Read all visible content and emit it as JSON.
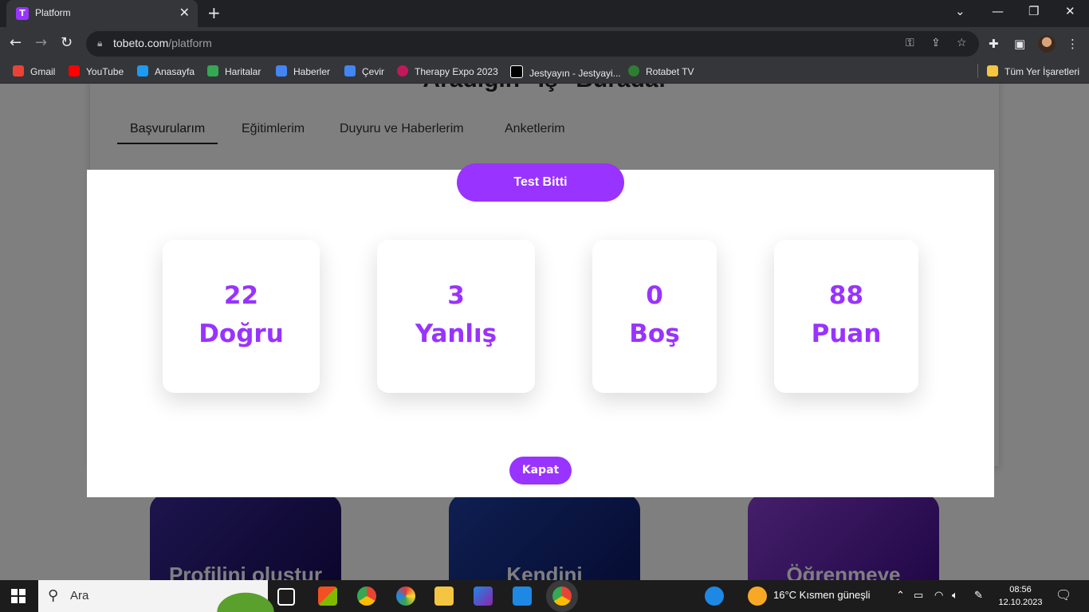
{
  "browser": {
    "tab_title": "Platform",
    "tab_favicon": "T",
    "url_host": "tobeto.com",
    "url_path": "/platform",
    "bookmarks": [
      {
        "label": "Gmail",
        "color": "#ea4335"
      },
      {
        "label": "YouTube",
        "color": "#ff0000"
      },
      {
        "label": "Anasayfa",
        "color": "#1d9bf0"
      },
      {
        "label": "Haritalar",
        "color": "#34a853"
      },
      {
        "label": "Haberler",
        "color": "#4285f4"
      },
      {
        "label": "Çevir",
        "color": "#4285f4"
      },
      {
        "label": "Therapy Expo 2023",
        "color": "#c2185b"
      },
      {
        "label": "Jestyayın - Jestyayi...",
        "color": "#000000"
      },
      {
        "label": "Rotabet TV",
        "color": "#2e7d32"
      }
    ],
    "all_bookmarks": "Tüm Yer İşaretleri"
  },
  "page": {
    "heading": "Aradığın \"İş\" Burada!",
    "tabs": [
      "Başvurularım",
      "Eğitimlerim",
      "Duyuru ve Haberlerim",
      "Anketlerim"
    ],
    "cards": [
      "Profilini oluştur",
      "Kendini",
      "Öğrenmeye"
    ]
  },
  "modal": {
    "title": "Test Bitti",
    "stats": [
      {
        "value": "22",
        "label": "Doğru"
      },
      {
        "value": "3",
        "label": "Yanlış"
      },
      {
        "value": "0",
        "label": "Boş"
      },
      {
        "value": "88",
        "label": "Puan"
      }
    ],
    "close_label": "Kapat",
    "accent_color": "#9933ff"
  },
  "taskbar": {
    "search_placeholder": "Ara",
    "weather": "16°C  Kısmen güneşli",
    "time": "08:56",
    "date": "12.10.2023"
  }
}
